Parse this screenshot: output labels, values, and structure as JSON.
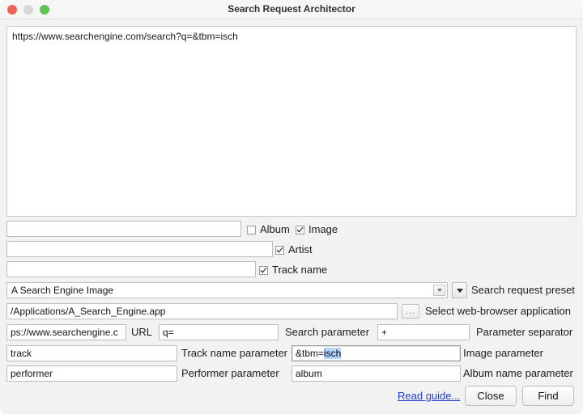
{
  "window": {
    "title": "Search Request Architector",
    "traffic_lights": [
      "close-red",
      "minimize-gray",
      "zoom-green"
    ]
  },
  "preview": {
    "url": "https://www.searchengine.com/search?q=&tbm=isch"
  },
  "query_rows": [
    {
      "field_value": "",
      "checkboxes": [
        {
          "label": "Album",
          "checked": false
        },
        {
          "label": "Image",
          "checked": true
        }
      ]
    },
    {
      "field_value": "",
      "checkboxes": [
        {
          "label": "Artist",
          "checked": true
        }
      ]
    },
    {
      "field_value": "",
      "checkboxes": [
        {
          "label": "Track name",
          "checked": true
        }
      ]
    }
  ],
  "preset": {
    "value": "A Search Engine Image",
    "label": "Search request preset",
    "combo_arrow_icon": "chevron-down-icon",
    "dropdown_arrow_icon": "chevron-down-icon"
  },
  "browser": {
    "value": "/Applications/A_Search_Engine.app",
    "label": "Select web-browser application",
    "browse_label": "..."
  },
  "params": {
    "url": {
      "value": "ps://www.searchengine.c",
      "label": "URL"
    },
    "search": {
      "value": "q=",
      "label": "Search parameter"
    },
    "separator": {
      "value": "+",
      "label": "Parameter separator"
    },
    "track": {
      "value": "track",
      "label": "Track name parameter"
    },
    "image": {
      "value_prefix": "&tbm=",
      "value_selected": "isch",
      "label": "Image parameter"
    },
    "performer": {
      "value": "performer",
      "label": "Performer parameter"
    },
    "album": {
      "value": "album",
      "label": "Album name parameter"
    }
  },
  "footer": {
    "guide_link": "Read guide...",
    "close_label": "Close",
    "find_label": "Find"
  },
  "colors": {
    "window_background": "#f2f2f2",
    "titlebar": "#f6f6f6",
    "field_background": "#ffffff",
    "selection": "#b4d5fe",
    "link": "#2040d0",
    "light_red": "#f0655a",
    "light_gray": "#d8d8d8",
    "light_green": "#5fc454"
  }
}
